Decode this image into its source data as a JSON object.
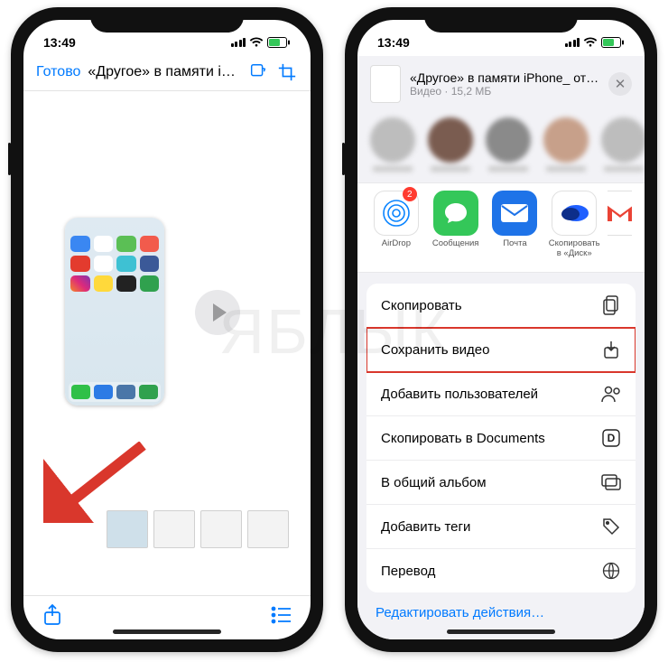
{
  "status": {
    "time": "13:49"
  },
  "left": {
    "nav": {
      "done": "Готово",
      "title": "«Другое» в памяти iPh..."
    }
  },
  "share": {
    "header": {
      "title": "«Другое» в памяти iPhone_ откуда б...",
      "subtitle": "Видео · 15,2 МБ"
    },
    "apps": {
      "airdrop": "AirDrop",
      "messages": "Сообщения",
      "mail": "Почта",
      "disk": "Скопировать в «Диск»",
      "gmail": ""
    },
    "airdrop_badge": "2",
    "actions": {
      "copy": "Скопировать",
      "save_video": "Сохранить видео",
      "add_people": "Добавить пользователей",
      "copy_documents": "Скопировать в Documents",
      "shared_album": "В общий альбом",
      "add_tags": "Добавить теги",
      "translate": "Перевод"
    },
    "edit": "Редактировать действия…"
  }
}
